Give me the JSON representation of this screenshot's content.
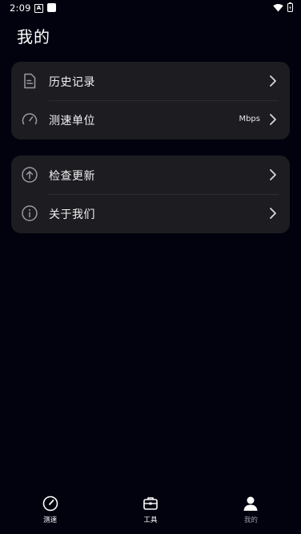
{
  "status_bar": {
    "time": "2:09",
    "notification_badge": "A"
  },
  "page": {
    "title": "我的"
  },
  "menu_group_1": {
    "items": [
      {
        "label": "历史记录",
        "value": "",
        "icon": "document-icon"
      },
      {
        "label": "测速单位",
        "value": "Mbps",
        "icon": "speedometer-icon"
      }
    ]
  },
  "menu_group_2": {
    "items": [
      {
        "label": "检查更新",
        "value": "",
        "icon": "arrow-up-circle-icon"
      },
      {
        "label": "关于我们",
        "value": "",
        "icon": "info-circle-icon"
      }
    ]
  },
  "bottom_nav": {
    "items": [
      {
        "label": "测速",
        "icon": "speedometer-icon",
        "active": false
      },
      {
        "label": "工具",
        "icon": "toolbox-icon",
        "active": false
      },
      {
        "label": "我的",
        "icon": "person-icon",
        "active": true
      }
    ]
  },
  "colors": {
    "background": "#02020f",
    "card": "#1c1c21",
    "divider": "#2c2c33",
    "icon_gray": "#9a9aa3"
  }
}
